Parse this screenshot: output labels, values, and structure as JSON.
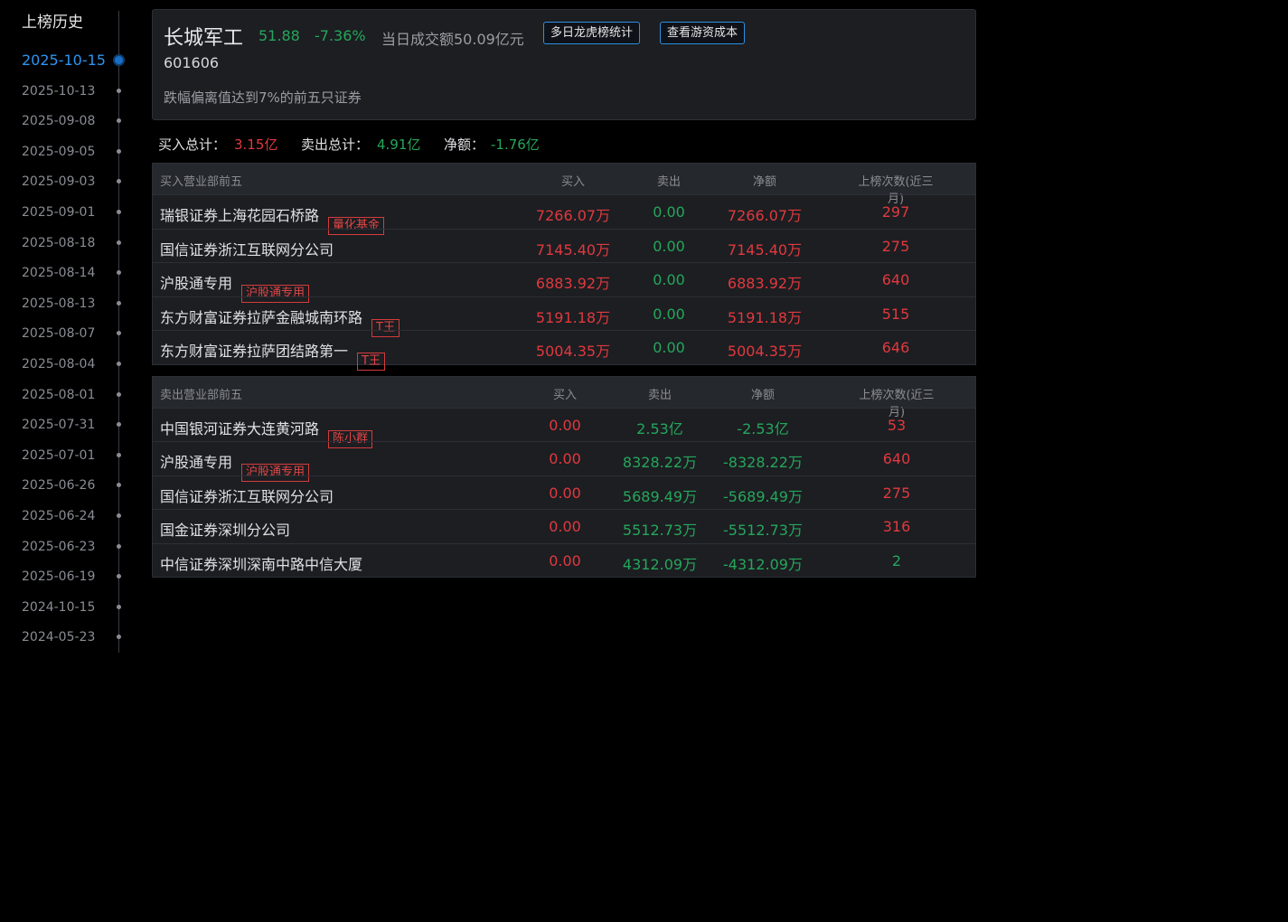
{
  "sidebar": {
    "title": "上榜历史",
    "dates": [
      {
        "label": "2025-10-15",
        "active": true
      },
      {
        "label": "2025-10-13"
      },
      {
        "label": "2025-09-08"
      },
      {
        "label": "2025-09-05"
      },
      {
        "label": "2025-09-03"
      },
      {
        "label": "2025-09-01"
      },
      {
        "label": "2025-08-18"
      },
      {
        "label": "2025-08-14"
      },
      {
        "label": "2025-08-13"
      },
      {
        "label": "2025-08-07"
      },
      {
        "label": "2025-08-04"
      },
      {
        "label": "2025-08-01"
      },
      {
        "label": "2025-07-31"
      },
      {
        "label": "2025-07-01"
      },
      {
        "label": "2025-06-26"
      },
      {
        "label": "2025-06-24"
      },
      {
        "label": "2025-06-23"
      },
      {
        "label": "2025-06-19"
      },
      {
        "label": "2024-10-15"
      },
      {
        "label": "2024-05-23"
      }
    ]
  },
  "header": {
    "name": "长城军工",
    "price": "51.88",
    "change": "-7.36%",
    "turnover": "当日成交额50.09亿元",
    "btn_multi": "多日龙虎榜统计",
    "btn_cost": "查看游资成本",
    "code": "601606",
    "reason": "跌幅偏离值达到7%的前五只证券"
  },
  "totals": {
    "buy_label": "买入总计：",
    "buy_value": "3.15亿",
    "sell_label": "卖出总计：",
    "sell_value": "4.91亿",
    "net_label": "净额：",
    "net_value": "-1.76亿"
  },
  "buy_table": {
    "headers": [
      "买入营业部前五",
      "买入",
      "卖出",
      "净额",
      "上榜次数(近三月)"
    ],
    "rows": [
      {
        "name": "瑞银证券上海花园石桥路",
        "tag": "量化基金",
        "buy": "7266.07万",
        "sell": "0.00",
        "net": "7266.07万",
        "count": "297"
      },
      {
        "name": "国信证券浙江互联网分公司",
        "tag": "",
        "buy": "7145.40万",
        "sell": "0.00",
        "net": "7145.40万",
        "count": "275"
      },
      {
        "name": "沪股通专用",
        "tag": "沪股通专用",
        "buy": "6883.92万",
        "sell": "0.00",
        "net": "6883.92万",
        "count": "640"
      },
      {
        "name": "东方财富证券拉萨金融城南环路",
        "tag": "T王",
        "buy": "5191.18万",
        "sell": "0.00",
        "net": "5191.18万",
        "count": "515"
      },
      {
        "name": "东方财富证券拉萨团结路第一",
        "tag": "T王",
        "buy": "5004.35万",
        "sell": "0.00",
        "net": "5004.35万",
        "count": "646"
      }
    ]
  },
  "sell_table": {
    "headers": [
      "卖出营业部前五",
      "买入",
      "卖出",
      "净额",
      "上榜次数(近三月)"
    ],
    "rows": [
      {
        "name": "中国银河证券大连黄河路",
        "tag": "陈小群",
        "buy": "0.00",
        "sell": "2.53亿",
        "net": "-2.53亿",
        "count": "53"
      },
      {
        "name": "沪股通专用",
        "tag": "沪股通专用",
        "buy": "0.00",
        "sell": "8328.22万",
        "net": "-8328.22万",
        "count": "640"
      },
      {
        "name": "国信证券浙江互联网分公司",
        "tag": "",
        "buy": "0.00",
        "sell": "5689.49万",
        "net": "-5689.49万",
        "count": "275"
      },
      {
        "name": "国金证券深圳分公司",
        "tag": "",
        "buy": "0.00",
        "sell": "5512.73万",
        "net": "-5512.73万",
        "count": "316"
      },
      {
        "name": "中信证券深圳深南中路中信大厦",
        "tag": "",
        "buy": "0.00",
        "sell": "4312.09万",
        "net": "-4312.09万",
        "count": "2",
        "count_color": "green"
      }
    ]
  },
  "colors": {
    "up": "#e0393e",
    "down": "#26a65b",
    "accent": "#2e95f0"
  }
}
